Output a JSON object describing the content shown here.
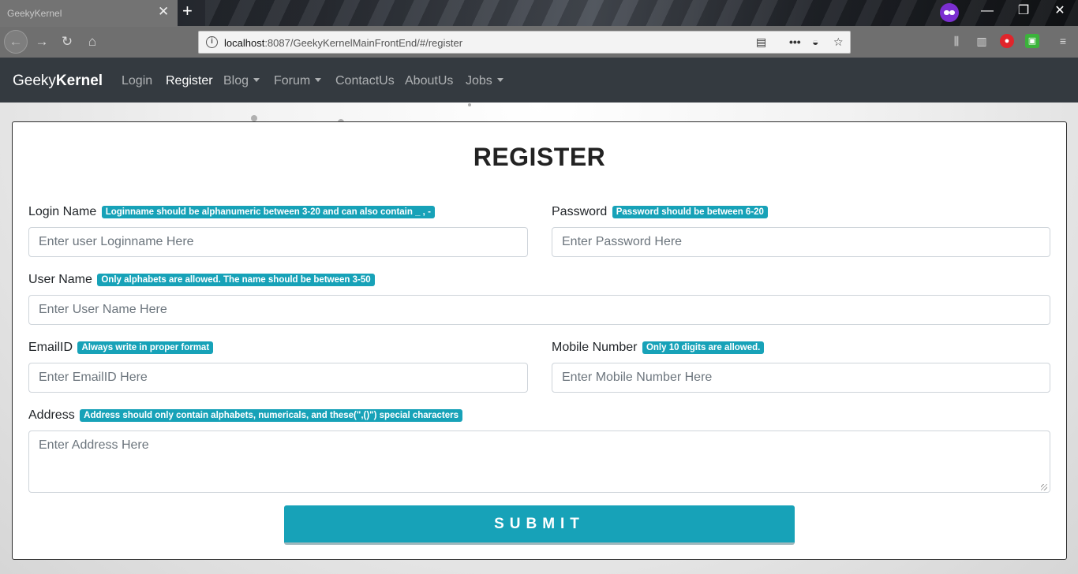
{
  "browser": {
    "tab_title": "GeekyKernel",
    "tab_close": "✕",
    "new_tab": "+",
    "url_host": "localhost",
    "url_rest": ":8087/GeekyKernelMainFrontEnd/#/register",
    "minimize": "—",
    "restore": "❐",
    "close": "✕"
  },
  "navbar": {
    "brand_light": "Geeky",
    "brand_bold": "Kernel",
    "links": [
      {
        "label": "Login"
      },
      {
        "label": "Register"
      },
      {
        "label": "Blog"
      },
      {
        "label": "Forum"
      },
      {
        "label": "ContactUs"
      },
      {
        "label": "AboutUs"
      },
      {
        "label": "Jobs"
      }
    ]
  },
  "form": {
    "title": "REGISTER",
    "login_name": {
      "label": "Login Name",
      "hint": "Loginname should be alphanumeric between 3-20 and can also contain _ , -",
      "placeholder": "Enter user Loginname Here"
    },
    "password": {
      "label": "Password",
      "hint": "Password should be between 6-20",
      "placeholder": "Enter Password Here"
    },
    "user_name": {
      "label": "User Name",
      "hint": "Only alphabets are allowed. The name should be between 3-50",
      "placeholder": "Enter User Name Here"
    },
    "email": {
      "label": "EmailID",
      "hint": "Always write in proper format",
      "placeholder": "Enter EmailID Here"
    },
    "mobile": {
      "label": "Mobile Number",
      "hint": "Only 10 digits are allowed.",
      "placeholder": "Enter Mobile Number Here"
    },
    "address": {
      "label": "Address",
      "hint": "Address should only contain alphabets, numericals, and these(\",()\") special characters",
      "placeholder": "Enter Address Here"
    },
    "submit_label": "SUBMIT"
  },
  "colors": {
    "accent": "#17a2b8",
    "navbar_bg": "#343a40"
  }
}
